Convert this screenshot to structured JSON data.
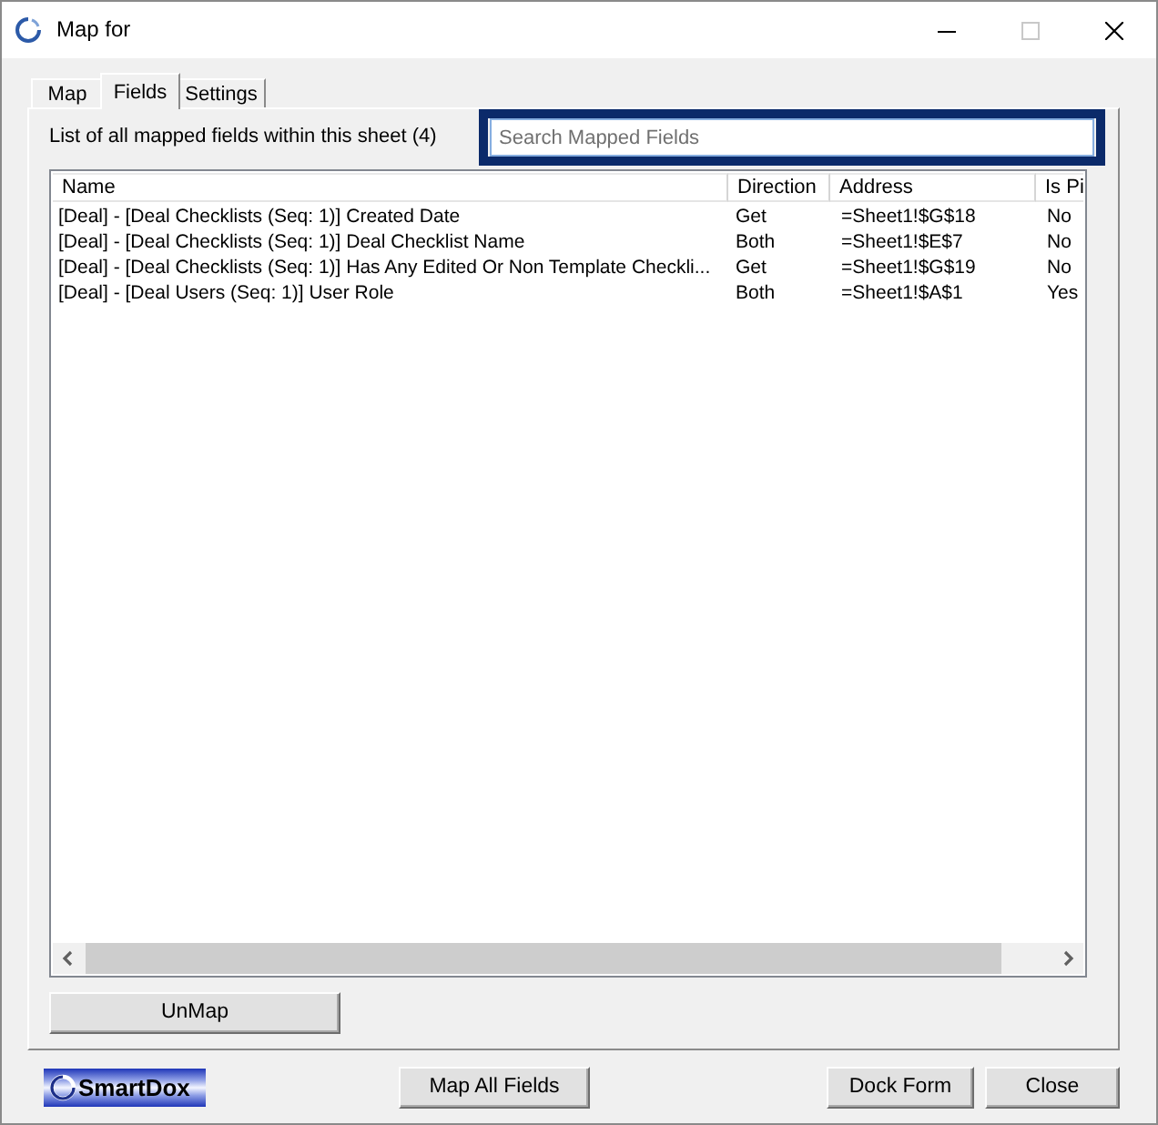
{
  "window": {
    "title": "Map for",
    "controls": [
      {
        "kind": "minimize",
        "disabled": false
      },
      {
        "kind": "maximize",
        "disabled": true
      },
      {
        "kind": "close",
        "disabled": false
      }
    ]
  },
  "tabs": [
    {
      "label": "Map",
      "selected": false
    },
    {
      "label": "Fields",
      "selected": true
    },
    {
      "label": "Settings",
      "selected": false
    }
  ],
  "fields_tab": {
    "summary": "List of all mapped fields within this sheet (4)",
    "search": {
      "placeholder": "Search Mapped Fields",
      "highlighted": true
    },
    "table": {
      "columns": [
        "Name",
        "Direction",
        "Address",
        "Is Pi"
      ],
      "rows": [
        [
          "[Deal] - [Deal Checklists (Seq: 1)] Created Date",
          "Get",
          "=Sheet1!$G$18",
          "No"
        ],
        [
          "[Deal] - [Deal Checklists (Seq: 1)] Deal Checklist Name",
          "Both",
          "=Sheet1!$E$7",
          "No"
        ],
        [
          "[Deal] - [Deal Checklists (Seq: 1)] Has Any Edited Or Non Template Checkli...",
          "Get",
          "=Sheet1!$G$19",
          "No"
        ],
        [
          "[Deal] - [Deal Users (Seq: 1)] User Role",
          "Both",
          "=Sheet1!$A$1",
          "Yes"
        ]
      ]
    },
    "unmap_button": "UnMap"
  },
  "footer": {
    "logo": "SmartDox",
    "buttons": [
      "Map All Fields",
      "Dock Form",
      "Close"
    ]
  }
}
